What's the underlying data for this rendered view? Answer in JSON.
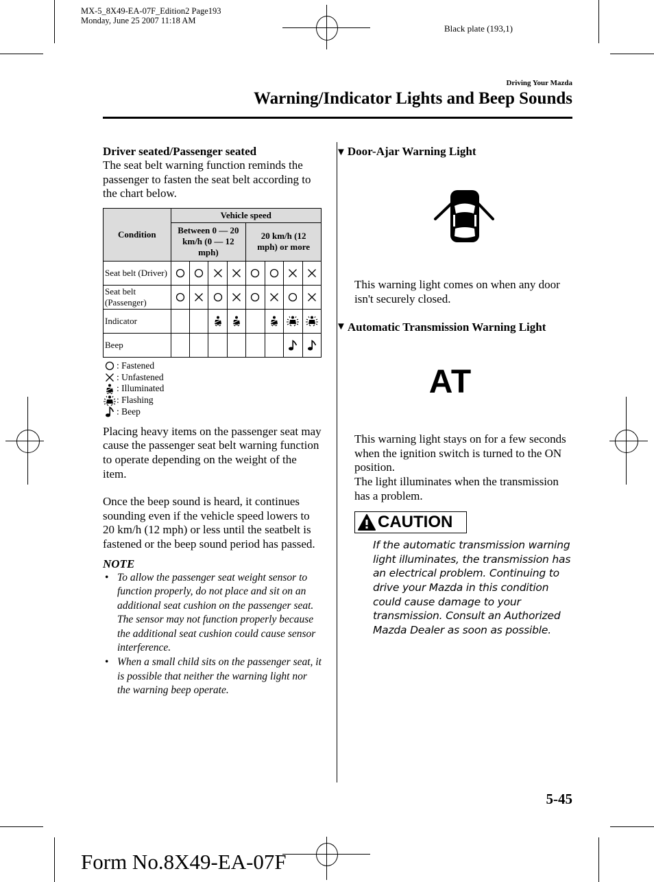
{
  "print_slug": {
    "line1": "MX-5_8X49-EA-07F_Edition2 Page193",
    "line2": "Monday, June 25 2007 11:18 AM",
    "plate": "Black plate (193,1)"
  },
  "header": {
    "section": "Driving Your Mazda",
    "title": "Warning/Indicator Lights and Beep Sounds"
  },
  "left_column": {
    "subhead": "Driver seated/Passenger seated",
    "intro": "The seat belt warning function reminds the passenger to fasten the seat belt according to the chart below.",
    "table": {
      "condition_header": "Condition",
      "speed_header": "Vehicle speed",
      "speed_low": "Between 0 — 20 km/h (0 — 12 mph)",
      "speed_high": "20 km/h (12 mph) or more",
      "rows": [
        {
          "label": "Seat belt (Driver)",
          "cells": [
            "fastened",
            "fastened",
            "unfastened",
            "unfastened",
            "fastened",
            "fastened",
            "unfastened",
            "unfastened"
          ]
        },
        {
          "label": "Seat belt (Passenger)",
          "cells": [
            "fastened",
            "unfastened",
            "fastened",
            "unfastened",
            "fastened",
            "unfastened",
            "fastened",
            "unfastened"
          ]
        },
        {
          "label": "Indicator",
          "cells": [
            "",
            "",
            "illuminated",
            "illuminated",
            "",
            "illuminated",
            "flashing",
            "flashing"
          ]
        },
        {
          "label": "Beep",
          "cells": [
            "",
            "",
            "",
            "",
            "",
            "",
            "beep",
            "beep"
          ]
        }
      ]
    },
    "legend": [
      {
        "icon": "fastened",
        "label": ": Fastened"
      },
      {
        "icon": "unfastened",
        "label": ": Unfastened"
      },
      {
        "icon": "illuminated",
        "label": ": Illuminated"
      },
      {
        "icon": "flashing",
        "label": ": Flashing"
      },
      {
        "icon": "beep",
        "label": ": Beep"
      }
    ],
    "para1": "Placing heavy items on the passenger seat may cause the passenger seat belt warning function to operate depending on the weight of the item.",
    "para2": "Once the beep sound is heard, it continues sounding even if the vehicle speed lowers to 20 km/h (12 mph) or less until the seatbelt is fastened or the beep sound period has passed.",
    "note_title": "NOTE",
    "notes": [
      "To allow the passenger seat weight sensor to function properly, do not place and sit on an additional seat cushion on the passenger seat. The sensor may not function properly because the additional seat cushion could cause sensor interference.",
      "When a small child sits on the passenger seat, it is possible that neither the warning light nor the warning beep operate."
    ]
  },
  "right_column": {
    "door_ajar": {
      "heading": "Door-Ajar Warning Light",
      "icon": "door-ajar-icon",
      "text": "This warning light comes on when any door isn't securely closed."
    },
    "at_warning": {
      "heading": "Automatic Transmission Warning Light",
      "icon_text": "AT",
      "text1": "This warning light stays on for a few seconds when the ignition switch is turned to the ON position.",
      "text2": "The light illuminates when the transmission has a problem."
    },
    "caution": {
      "label": "CAUTION",
      "text": "If the automatic transmission warning light illuminates, the transmission has an electrical problem. Continuing to drive your Mazda in this condition could cause damage to your transmission. Consult an Authorized Mazda Dealer as soon as possible."
    }
  },
  "footer": {
    "page_number": "5-45",
    "form_number": "Form No.8X49-EA-07F"
  }
}
